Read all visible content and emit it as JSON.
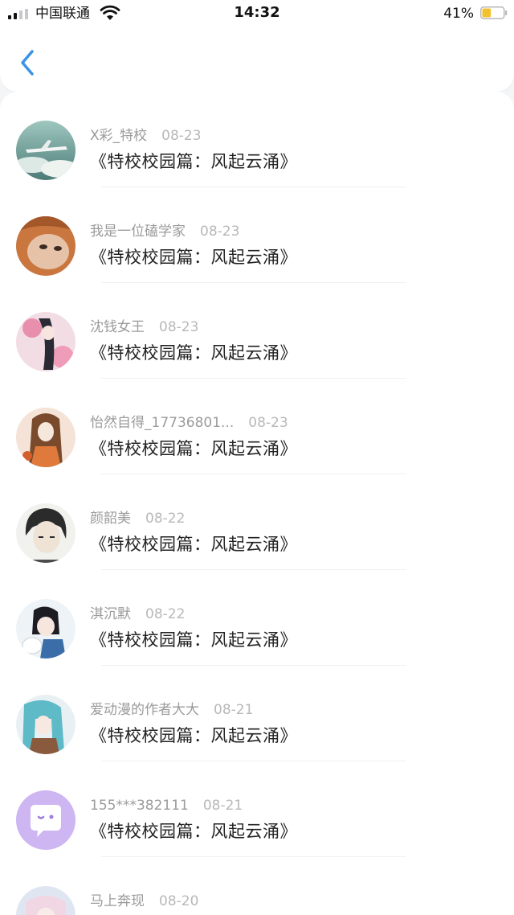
{
  "status_bar": {
    "carrier": "中国联通",
    "time": "14:32",
    "battery_percent": "41%",
    "battery_level": 0.41
  },
  "nav": {
    "back_icon": "chevron-left-icon",
    "accent_color": "#3a93e6"
  },
  "items": [
    {
      "user": "X彩_特校",
      "date": "08-23",
      "title": "《特校校园篇：风起云涌》"
    },
    {
      "user": "我是一位磕学家",
      "date": "08-23",
      "title": "《特校校园篇：风起云涌》"
    },
    {
      "user": "沈钱女王",
      "date": "08-23",
      "title": "《特校校园篇：风起云涌》"
    },
    {
      "user": "怡然自得_17736801...",
      "date": "08-23",
      "title": "《特校校园篇：风起云涌》"
    },
    {
      "user": "颜韶美",
      "date": "08-22",
      "title": "《特校校园篇：风起云涌》"
    },
    {
      "user": "淇沉默",
      "date": "08-22",
      "title": "《特校校园篇：风起云涌》"
    },
    {
      "user": "爱动漫的作者大大",
      "date": "08-21",
      "title": "《特校校园篇：风起云涌》"
    },
    {
      "user": "155***382111",
      "date": "08-21",
      "title": "《特校校园篇：风起云涌》"
    },
    {
      "user": "马上奔现",
      "date": "08-20",
      "title": ""
    }
  ]
}
